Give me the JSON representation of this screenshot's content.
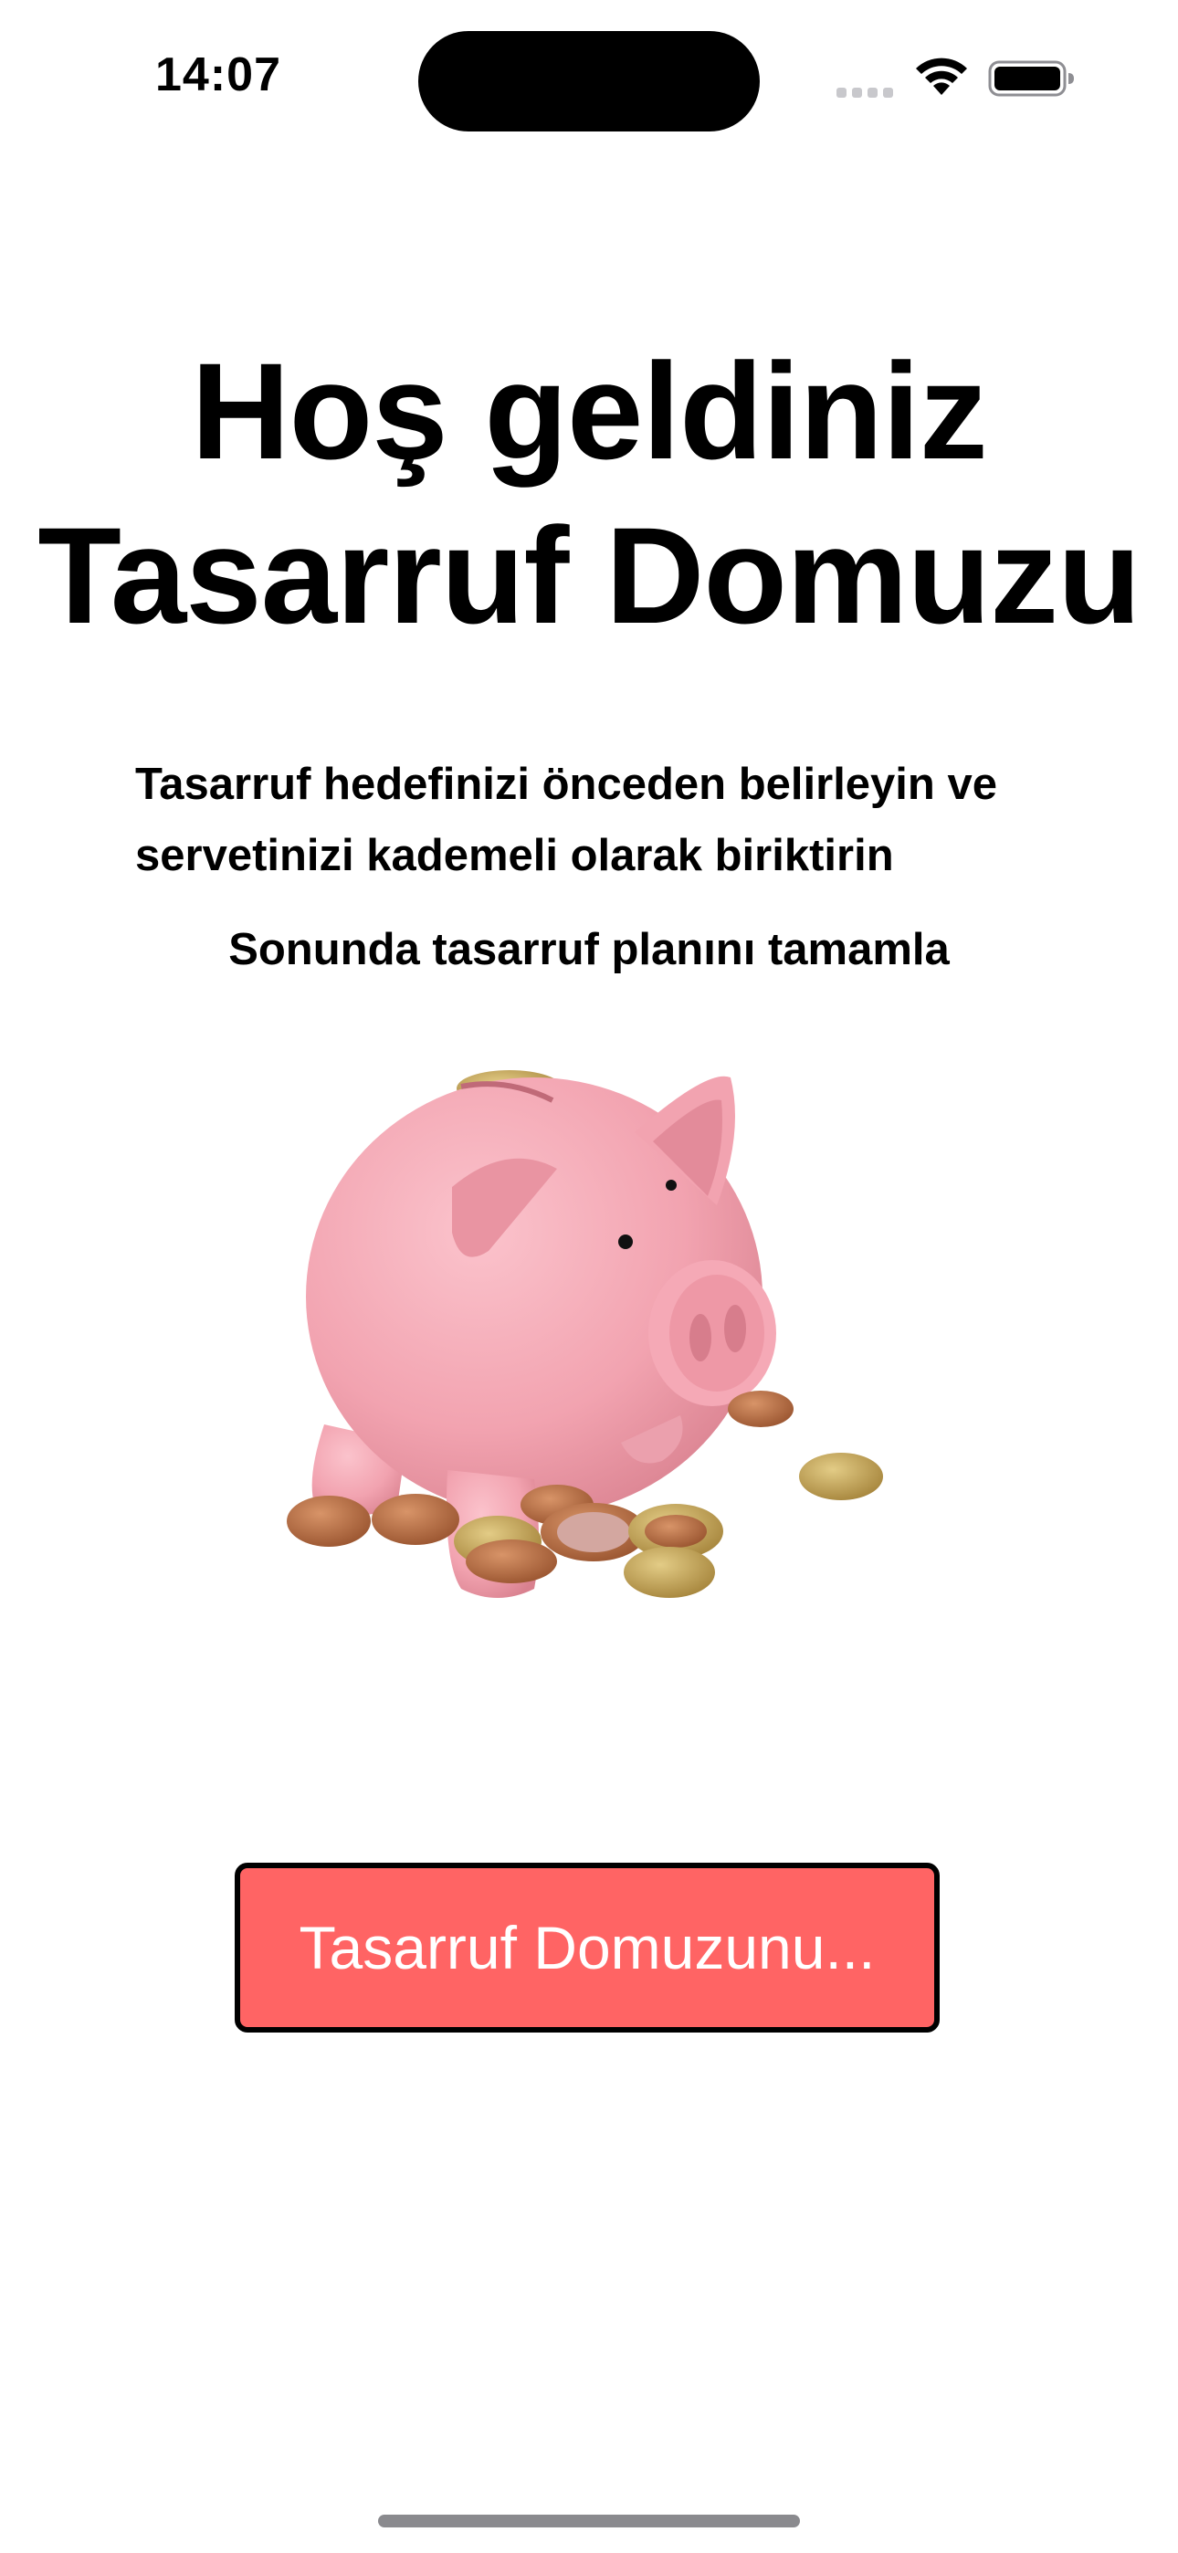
{
  "status_bar": {
    "time": "14:07",
    "icons": [
      "signal-icon",
      "wifi-icon",
      "battery-icon"
    ]
  },
  "welcome": {
    "title_line1": "Hoş geldiniz",
    "title_line2": "Tasarruf Domuzu",
    "description": "Tasarruf hedefinizi önceden belirleyin ve servetinizi kademeli olarak biriktirin",
    "subtitle": "Sonunda tasarruf planını tamamla"
  },
  "illustration": {
    "icon": "piggy-bank-with-coins"
  },
  "cta": {
    "label": "Tasarruf Domuzunu...",
    "background_color": "#ff6464",
    "text_color": "#ffffff"
  },
  "colors": {
    "background": "#ffffff",
    "pig_pink": "#f4a7b3",
    "coin_copper": "#b87044",
    "coin_gold": "#c9a95a"
  }
}
